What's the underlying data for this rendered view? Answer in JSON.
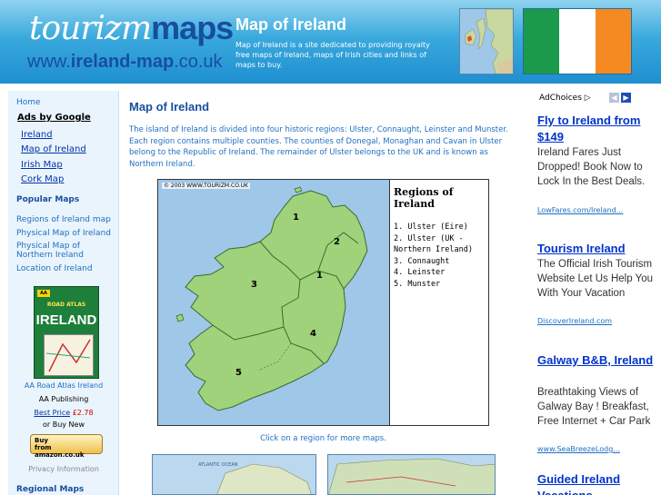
{
  "header": {
    "logo_word": "tourizm",
    "logo_word_bold": "maps",
    "logo_domain_prefix": "www.",
    "logo_domain_bold": "ireland-map",
    "logo_domain_suffix": ".co.uk",
    "title": "Map of Ireland",
    "description": "Map of Ireland is a site dedicated to providing royalty free maps of Ireland, maps of Irish cities and links of maps to buy.",
    "flag_colors": [
      "#1a9a4a",
      "#ffffff",
      "#f58a22"
    ]
  },
  "sidebar": {
    "home": "Home",
    "ads_by_google": "Ads by Google",
    "ad_links": [
      "Ireland",
      "Map of Ireland",
      "Irish Map",
      "Cork Map"
    ],
    "popular_heading": "Popular Maps",
    "popular_links": [
      "Regions of Ireland map",
      "Physical Map of Ireland",
      "Physical Map of Northern Ireland",
      "Location of Ireland"
    ],
    "book": {
      "cover_top": "ROAD ATLAS",
      "cover_title": "IRELAND",
      "title": "AA Road Atlas Ireland",
      "publisher": "AA Publishing",
      "best_price_label": "Best Price",
      "price": "£2.78",
      "or_buy_new": "or Buy New",
      "buy_line1": "Buy",
      "buy_line2": "from amazon.co.uk"
    },
    "privacy": "Privacy Information",
    "regional_heading": "Regional Maps"
  },
  "main": {
    "title": "Map of Ireland",
    "intro": "The island of Ireland is divided into four historic regions: Ulster, Connaught, Leinster and Munster. Each region contains multiple counties. The counties of Donegal, Monaghan and Cavan in Ulster belong to the Republic of Ireland. The remainder of Ulster belongs to the UK and is known as Northern Ireland.",
    "map": {
      "copyright": "© 2003 WWW.TOURIZM.CO.UK",
      "legend_title": "Regions of Ireland",
      "legend_items": [
        "1. Ulster (Eire)",
        "2. Ulster (UK - Northern Ireland)",
        "3. Connaught",
        "4. Leinster",
        "5. Munster"
      ],
      "region_numbers": [
        "1",
        "2",
        "1",
        "3",
        "4",
        "5"
      ]
    },
    "caption": "Click on a region for more maps.",
    "thumb_label": "ATLANTIC OCEAN"
  },
  "ads": {
    "adchoices": "AdChoices",
    "items": [
      {
        "title": "Fly to Ireland from $149",
        "body": "Ireland Fares Just Dropped! Book Now to Lock In the Best Deals.",
        "url": "LowFares.com/Ireland..."
      },
      {
        "title": "Tourism Ireland",
        "body": "The Official Irish Tourism Website Let Us Help You With Your Vacation",
        "url": "DiscoverIreland.com"
      },
      {
        "title": "Galway B&B, Ireland",
        "body": "Breathtaking Views of Galway Bay ! Breakfast, Free Internet + Car Park",
        "url": "www.SeaBreezeLodg..."
      },
      {
        "title": "Guided Ireland Vacations",
        "body": "",
        "url": ""
      }
    ]
  }
}
